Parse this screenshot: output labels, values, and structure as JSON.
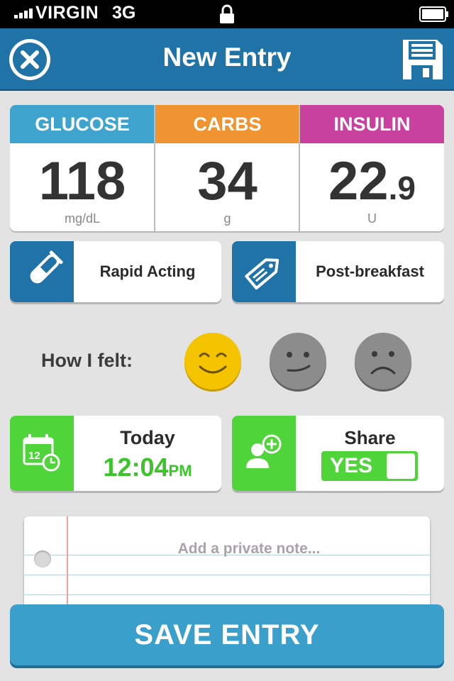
{
  "status_bar": {
    "carrier": "VIRGIN",
    "network": "3G"
  },
  "nav": {
    "title": "New Entry"
  },
  "metrics": [
    {
      "label": "GLUCOSE",
      "value": "118",
      "decimal": "",
      "unit": "mg/dL",
      "color": "#3fa4cd"
    },
    {
      "label": "CARBS",
      "value": "34",
      "decimal": "",
      "unit": "g",
      "color": "#ef9431"
    },
    {
      "label": "INSULIN",
      "value": "22",
      "decimal": ".9",
      "unit": "U",
      "color": "#c9419f"
    }
  ],
  "insulin_type": {
    "label": "Rapid Acting"
  },
  "meal_tag": {
    "label": "Post-breakfast"
  },
  "feeling": {
    "label": "How I felt:",
    "options": [
      "happy",
      "neutral",
      "sad"
    ],
    "selected": "happy"
  },
  "datetime": {
    "day": "Today",
    "time": "12:04",
    "ampm": "PM"
  },
  "share": {
    "label": "Share",
    "toggle": "YES",
    "enabled": true
  },
  "note": {
    "placeholder": "Add a private note..."
  },
  "save_button": {
    "label": "SAVE ENTRY"
  },
  "colors": {
    "nav": "#1f73a6",
    "green": "#4fd43a",
    "blue_side": "#1f73a6",
    "save": "#3aa0cb",
    "happy": "#f5c400",
    "gray_face": "#8a8a8a"
  }
}
